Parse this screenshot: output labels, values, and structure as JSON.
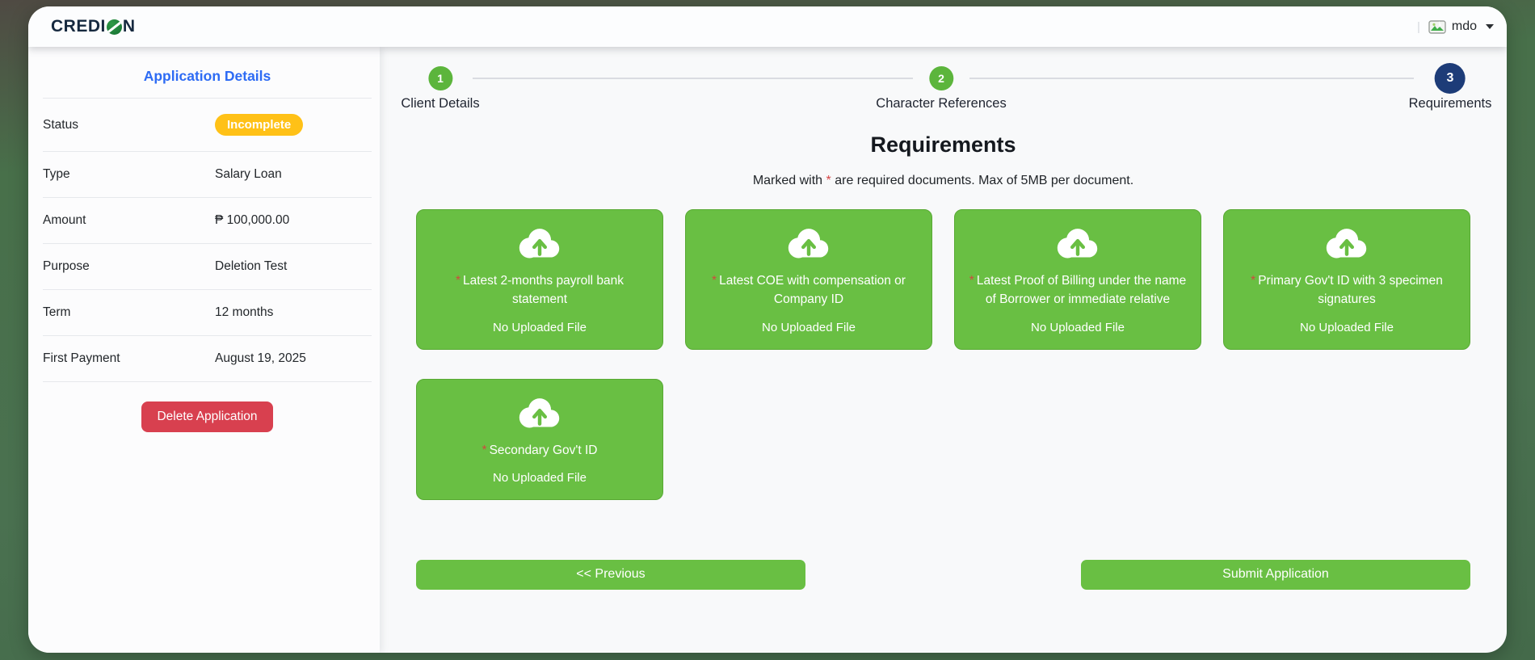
{
  "navbar": {
    "brand": {
      "part1": "CREDI",
      "part2": "N"
    },
    "divider": "|",
    "user": {
      "name": "mdo"
    }
  },
  "sidebar": {
    "title": "Application Details",
    "rows": [
      {
        "label": "Status",
        "value": "Incomplete"
      },
      {
        "label": "Type",
        "value": "Salary Loan"
      },
      {
        "label": "Amount",
        "value": "₱ 100,000.00"
      },
      {
        "label": "Purpose",
        "value": "Deletion Test"
      },
      {
        "label": "Term",
        "value": "12 months"
      },
      {
        "label": "First Payment",
        "value": "August 19, 2025"
      }
    ],
    "delete_button": "Delete Application"
  },
  "stepper": {
    "steps": [
      {
        "number": "1",
        "label": "Client Details"
      },
      {
        "number": "2",
        "label": "Character References"
      },
      {
        "number": "3",
        "label": "Requirements"
      }
    ]
  },
  "main": {
    "title": "Requirements",
    "note": {
      "prefix": "Marked with ",
      "asterisk": "*",
      "suffix": " are required documents. Max of 5MB per document."
    },
    "cards": [
      {
        "required": "*",
        "title": "Latest 2-months payroll bank statement",
        "status": "No Uploaded File"
      },
      {
        "required": "*",
        "title": "Latest COE with compensation or Company ID",
        "status": "No Uploaded File"
      },
      {
        "required": "*",
        "title": "Latest Proof of Billing under the name of Borrower or immediate relative",
        "status": "No Uploaded File"
      },
      {
        "required": "*",
        "title": "Primary Gov't ID with 3 specimen signatures",
        "status": "No Uploaded File"
      },
      {
        "required": "*",
        "title": "Secondary Gov't ID",
        "status": "No Uploaded File"
      }
    ],
    "previous_button": "<< Previous",
    "submit_button": "Submit Application"
  },
  "colors": {
    "accent_green": "#69bf43",
    "step_green": "#5cb53c",
    "step_navy": "#1d3c78",
    "badge_yellow": "#ffc117",
    "danger_red": "#d8404f",
    "link_blue": "#2d6bf4",
    "page_background_green": "#4a7150"
  }
}
